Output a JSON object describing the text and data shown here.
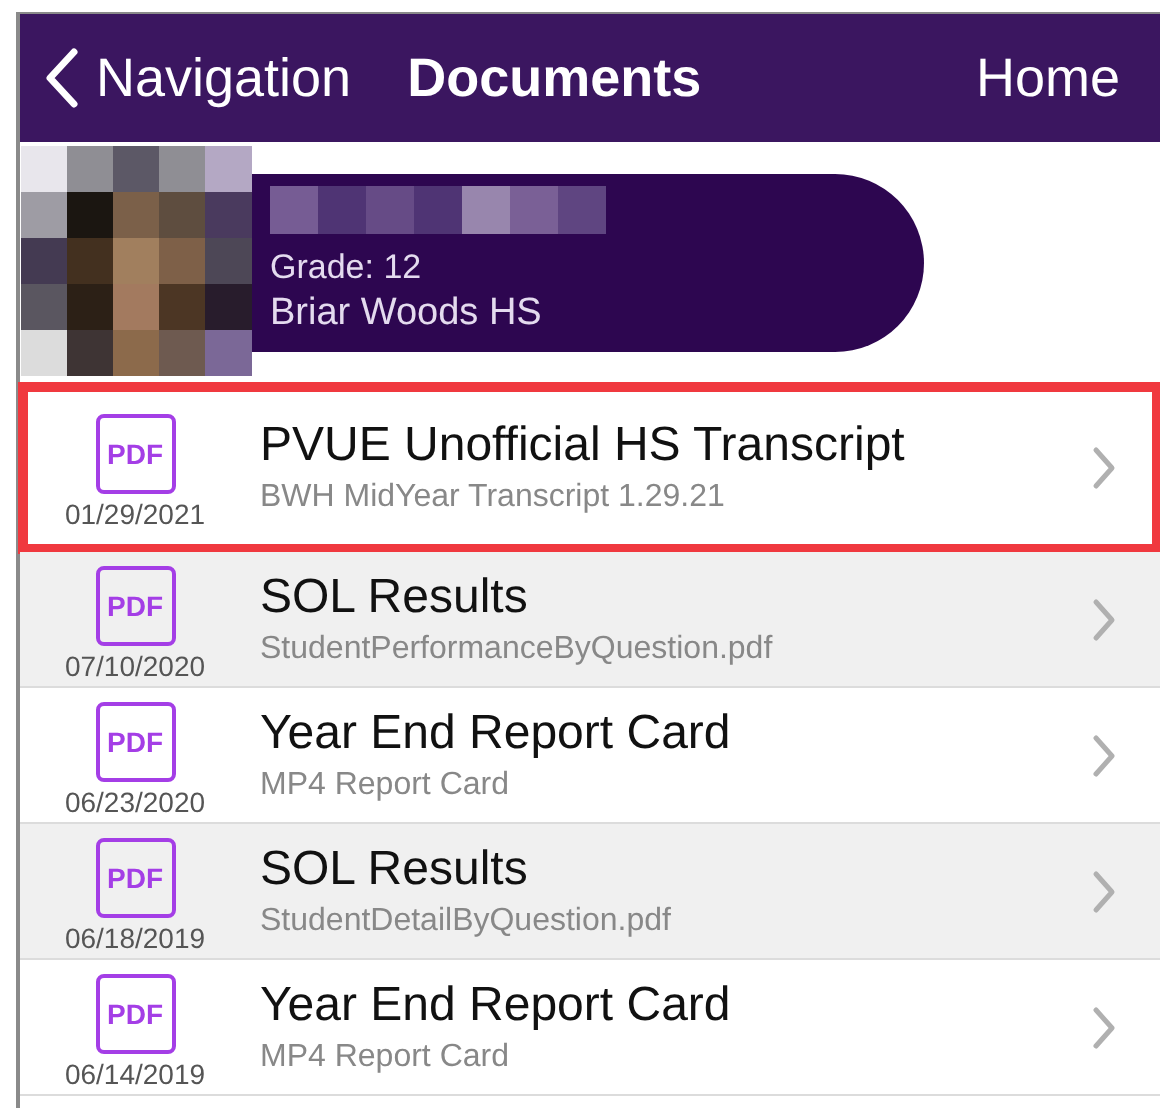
{
  "nav_bar": {
    "back_label": "Navigation",
    "title": "Documents",
    "home_label": "Home"
  },
  "student": {
    "grade": "Grade: 12",
    "school": "Briar Woods HS"
  },
  "documents": [
    {
      "title": "PVUE Unofficial HS Transcript",
      "subtitle": "BWH MidYear Transcript 1.29.21",
      "date": "01/29/2021",
      "icon_label": "PDF",
      "highlighted": true
    },
    {
      "title": "SOL Results",
      "subtitle": "StudentPerformanceByQuestion.pdf",
      "date": "07/10/2020",
      "icon_label": "PDF",
      "highlighted": false
    },
    {
      "title": "Year End Report Card",
      "subtitle": "MP4 Report Card",
      "date": "06/23/2020",
      "icon_label": "PDF",
      "highlighted": false
    },
    {
      "title": "SOL Results",
      "subtitle": "StudentDetailByQuestion.pdf",
      "date": "06/18/2019",
      "icon_label": "PDF",
      "highlighted": false
    },
    {
      "title": "Year End Report Card",
      "subtitle": "MP4 Report Card",
      "date": "06/14/2019",
      "icon_label": "PDF",
      "highlighted": false
    }
  ]
}
